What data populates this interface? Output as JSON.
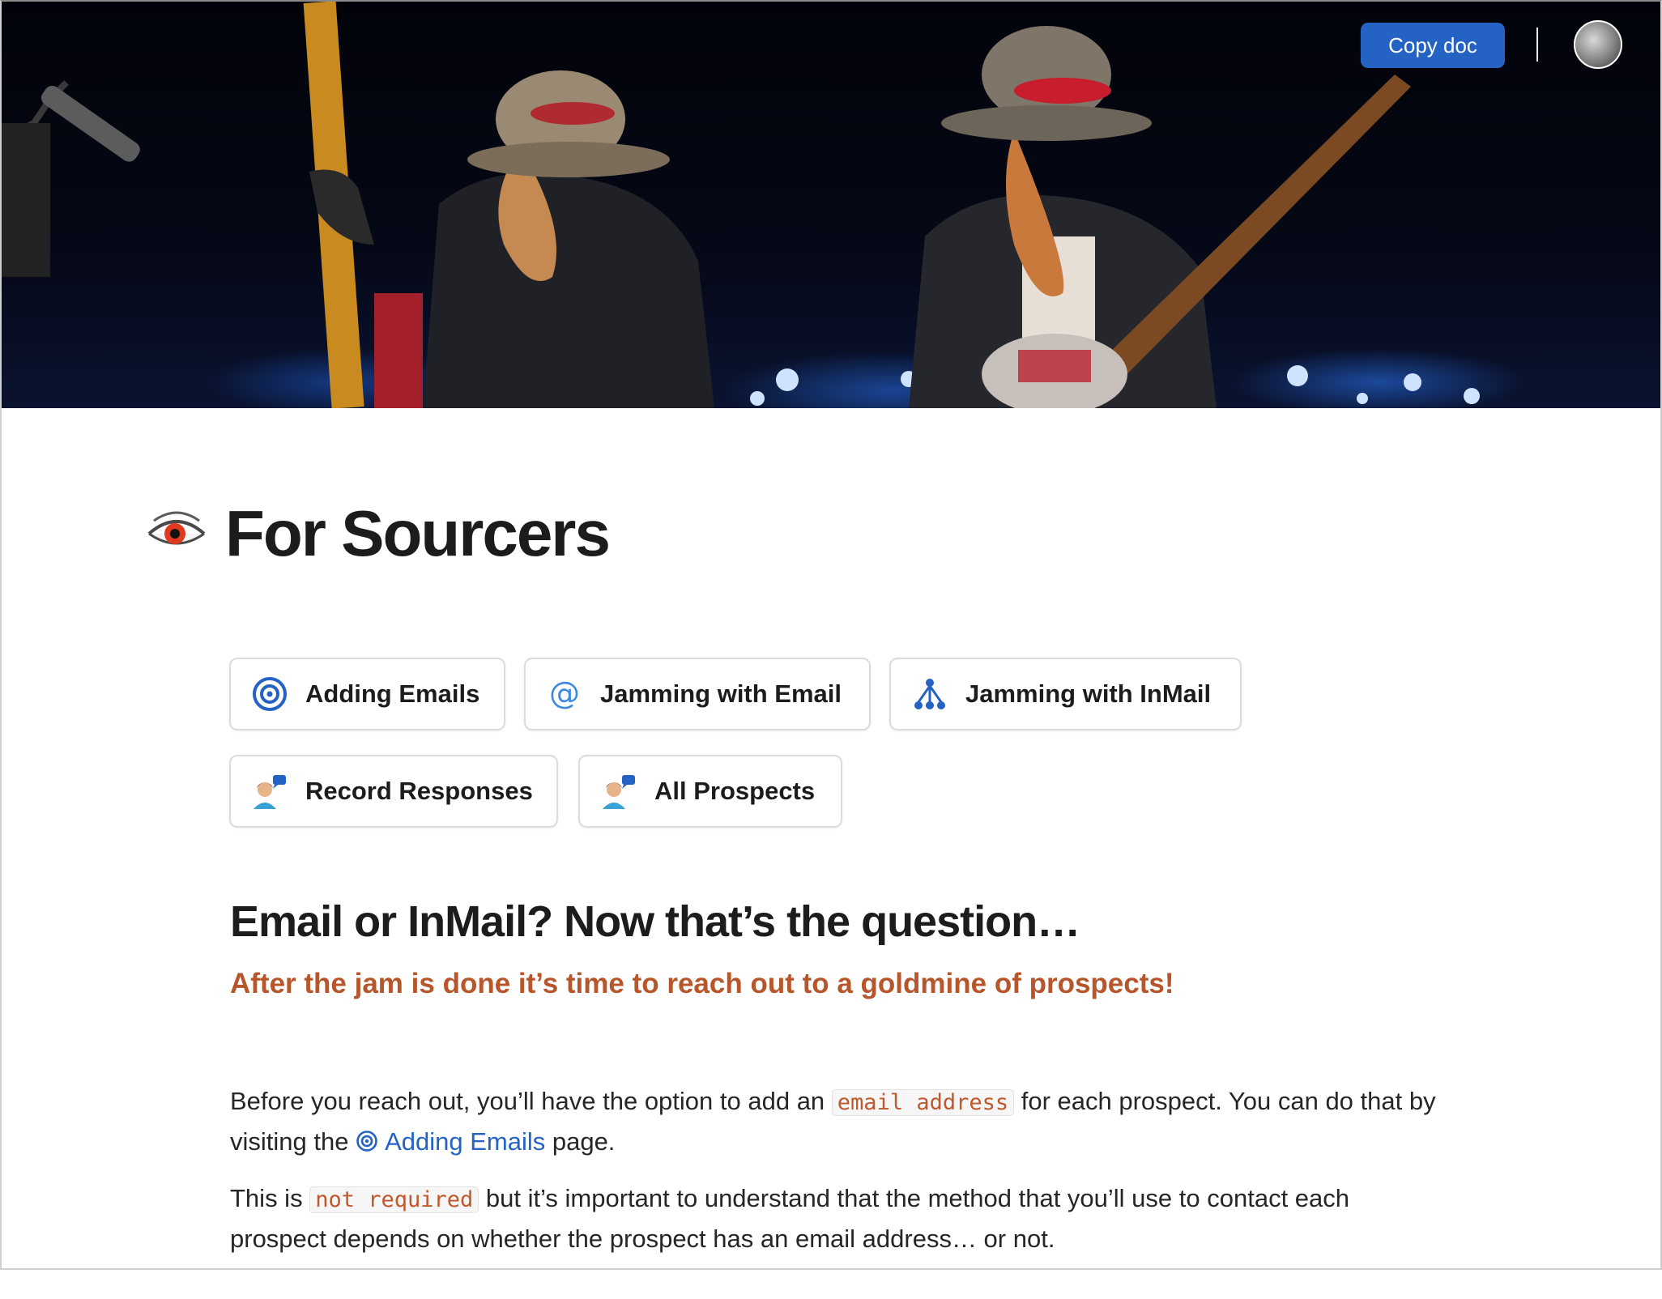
{
  "header": {
    "copy_doc_label": "Copy doc"
  },
  "page": {
    "title": "For Sourcers",
    "title_icon": "eye-icon"
  },
  "link_buttons": [
    {
      "label": "Adding Emails",
      "icon": "at-circle-icon"
    },
    {
      "label": "Jamming with Email",
      "icon": "at-sign-icon"
    },
    {
      "label": "Jamming with InMail",
      "icon": "network-icon"
    },
    {
      "label": "Record Responses",
      "icon": "person-speech-icon"
    },
    {
      "label": "All Prospects",
      "icon": "person-speech-icon"
    }
  ],
  "section": {
    "heading": "Email or InMail? Now that’s the question…",
    "subtitle": "After the jam is done it’s time to reach out to a goldmine of prospects!"
  },
  "paragraph1": {
    "before_code": "Before you reach out, you’ll have the option to add an ",
    "code": "email address",
    "after_code": " for each prospect. You can do that by visiting the ",
    "link_label": "Adding Emails",
    "after_link": " page."
  },
  "paragraph2": {
    "before_code": "This is ",
    "code": "not required",
    "after_code": " but it’s important to understand that the method that you’ll use to contact each prospect depends on whether the prospect has an email address… or not."
  },
  "colors": {
    "accent": "#2462c4",
    "subtitle": "#b7552b",
    "code_text": "#c0582d"
  }
}
